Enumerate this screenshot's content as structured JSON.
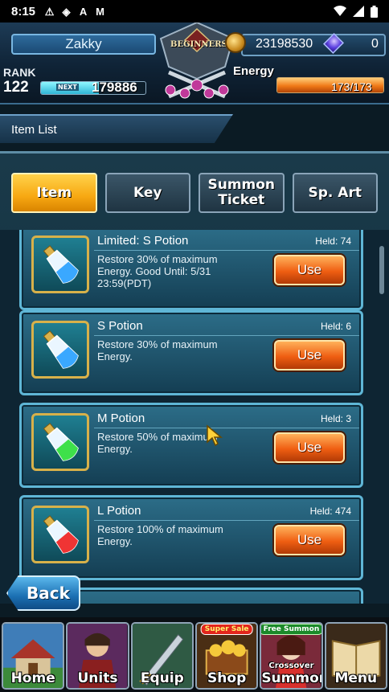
{
  "status_bar": {
    "time": "8:15"
  },
  "player": {
    "name": "Zakky",
    "rank_label": "RANK",
    "rank": "122",
    "next_label": "NEXT",
    "exp_to_next": "179886",
    "gold": "23198530",
    "gems": "0",
    "energy_label": "Energy",
    "energy": "173/173",
    "energy_fraction": 1.0,
    "exp_fraction": 0.55
  },
  "emblem": {
    "title": "BEGINNERS"
  },
  "page": {
    "title": "Item List"
  },
  "tabs": [
    {
      "label": "Item",
      "active": true
    },
    {
      "label": "Key",
      "active": false
    },
    {
      "label": "Summon Ticket",
      "active": false
    },
    {
      "label": "Sp. Art",
      "active": false
    }
  ],
  "items": [
    {
      "name": "Limited: S Potion",
      "held": "Held: 74",
      "description": "Restore 30% of maximum Energy. Good Until: 5/31 23:59(PDT)",
      "button": "Use",
      "potion_color": "#3aa8ff"
    },
    {
      "name": "S Potion",
      "held": "Held: 6",
      "description": "Restore 30% of maximum Energy.",
      "button": "Use",
      "potion_color": "#3aa8ff"
    },
    {
      "name": "M Potion",
      "held": "Held: 3",
      "description": "Restore 50% of maximum Energy.",
      "button": "Use",
      "potion_color": "#3ee04a"
    },
    {
      "name": "L Potion",
      "held": "Held: 474",
      "description": "Restore 100% of maximum Energy.",
      "button": "Use",
      "potion_color": "#f03434"
    }
  ],
  "back_button": "Back",
  "bottom_nav": [
    {
      "label": "Home"
    },
    {
      "label": "Units"
    },
    {
      "label": "Equip"
    },
    {
      "label": "Shop",
      "badge": "Super Sale"
    },
    {
      "label": "Summon",
      "sub": "Crossover",
      "badge": "Free Summon"
    },
    {
      "label": "Menu"
    }
  ],
  "colors": {
    "accent": "#f7a812",
    "use_button": "#ef5e12",
    "card_border": "#5fb6d6"
  }
}
